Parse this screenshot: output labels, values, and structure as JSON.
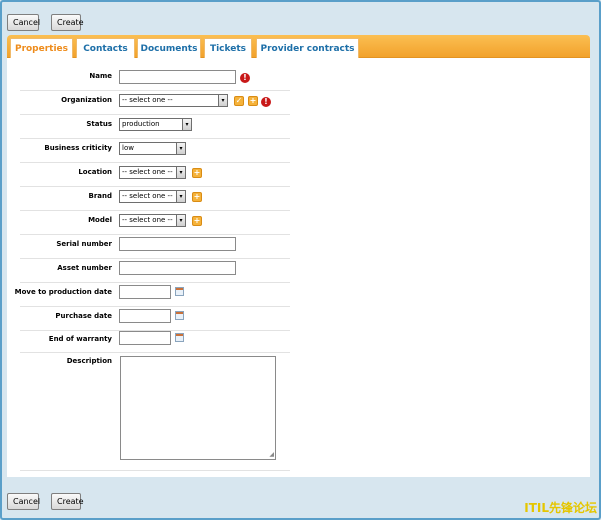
{
  "toolbar": {
    "cancel_label": "Cancel",
    "create_label": "Create"
  },
  "tabs": [
    "Properties",
    "Contacts",
    "Documents",
    "Tickets",
    "Provider contracts"
  ],
  "form": {
    "name_label": "Name",
    "name_value": "",
    "organization_label": "Organization",
    "organization_value": "-- select one --",
    "status_label": "Status",
    "status_value": "production",
    "criticity_label": "Business criticity",
    "criticity_value": "low",
    "location_label": "Location",
    "location_value": "-- select one --",
    "brand_label": "Brand",
    "brand_value": "-- select one --",
    "model_label": "Model",
    "model_value": "-- select one --",
    "serial_label": "Serial number",
    "serial_value": "",
    "asset_label": "Asset number",
    "asset_value": "",
    "move_prod_label": "Move to production date",
    "move_prod_value": "",
    "purchase_label": "Purchase date",
    "purchase_value": "",
    "warranty_label": "End of warranty",
    "warranty_value": "",
    "description_label": "Description",
    "description_value": ""
  },
  "icons": {
    "arrow": "▾",
    "error": "!",
    "plus": "+",
    "check": "✓",
    "grip": "◢"
  },
  "colors": {
    "accent": "#f2a22c",
    "tab_text": "#1d6fa8",
    "tab_active": "#ee8c1c",
    "error": "#c81818"
  },
  "watermark": "ITIL先锋论坛"
}
